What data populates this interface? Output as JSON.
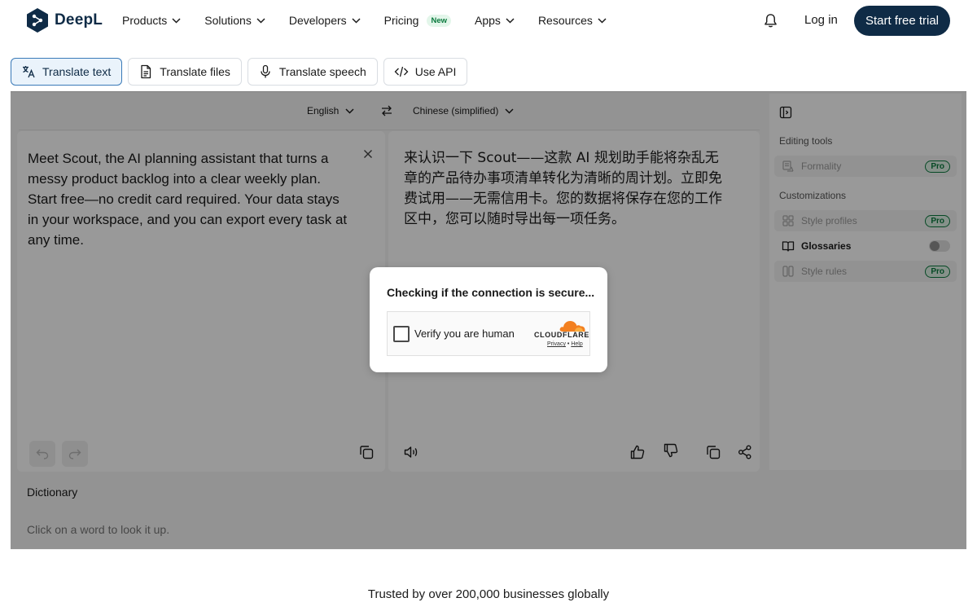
{
  "brand": {
    "name": "DeepL"
  },
  "nav": {
    "items": [
      {
        "label": "Products",
        "icon": "chevron-down-icon"
      },
      {
        "label": "Solutions",
        "icon": "chevron-down-icon"
      },
      {
        "label": "Developers",
        "icon": "chevron-down-icon"
      },
      {
        "label": "Pricing",
        "badge": "New"
      },
      {
        "label": "Apps",
        "icon": "chevron-down-icon"
      },
      {
        "label": "Resources",
        "icon": "chevron-down-icon"
      }
    ],
    "login": "Log in",
    "cta": "Start free trial"
  },
  "tabs": [
    {
      "label": "Translate text",
      "icon": "translate-icon",
      "active": true
    },
    {
      "label": "Translate files",
      "icon": "document-icon"
    },
    {
      "label": "Translate speech",
      "icon": "microphone-icon"
    },
    {
      "label": "Use API",
      "icon": "code-icon"
    }
  ],
  "translator": {
    "source_lang": "English",
    "target_lang": "Chinese (simplified)",
    "source_text": "Meet Scout, the AI planning assistant that turns a messy product backlog into a clear weekly plan. Start free—no credit card required. Your data stays in your workspace, and you can export every task at any time.",
    "target_text": "来认识一下 Scout——这款 AI 规划助手能将杂乱无章的产品待办事项清单转化为清晰的周计划。立即免费试用——无需信用卡。您的数据将保存在您的工作区中，您可以随时导出每一项任务。"
  },
  "side_panel": {
    "editing_heading": "Editing tools",
    "formality": "Formality",
    "customizations_heading": "Customizations",
    "style_profiles": "Style profiles",
    "glossaries": "Glossaries",
    "style_rules": "Style rules",
    "pro_badge": "Pro"
  },
  "dictionary": {
    "title": "Dictionary",
    "hint": "Click on a word to look it up."
  },
  "challenge": {
    "title": "Checking if the connection is secure...",
    "checkbox_label": "Verify you are human",
    "provider": "CLOUDFLARE",
    "privacy": "Privacy",
    "separator": "•",
    "help": "Help"
  },
  "footer": {
    "trusted": "Trusted by over 200,000 businesses globally"
  },
  "colors": {
    "brand_navy": "#0f2b46",
    "pro_green": "#0b7a3e",
    "cf_orange": "#f38020"
  }
}
